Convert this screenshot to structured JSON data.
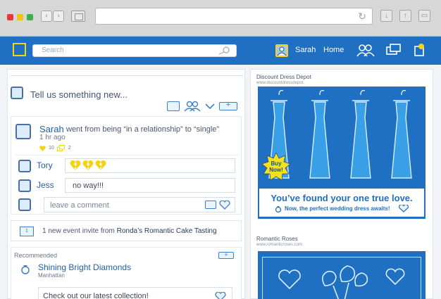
{
  "header": {
    "search_placeholder": "Search",
    "user_name": "Sarah",
    "home_label": "Home"
  },
  "composer": {
    "placeholder": "Tell us something new..."
  },
  "post": {
    "author": "Sarah",
    "action": "went from being “in a relationship” to “single”",
    "time": "1 hr ago",
    "likes": "10",
    "shares": "2",
    "comments": [
      {
        "name": "Tory",
        "text": ""
      },
      {
        "name": "Jess",
        "text": "no way!!!"
      }
    ],
    "comment_placeholder": "leave a comment"
  },
  "event": {
    "text_prefix": "1 new event invite from",
    "event_name": "Ronda’s Romantic Cake Tasting"
  },
  "recommended": {
    "label": "Recommended",
    "name": "Shining Bright Diamonds",
    "location": "Manhattan",
    "card_text": "Check out our latest collection!"
  },
  "ads": [
    {
      "title": "Discount Dress Depot",
      "url": "www.discountdressdepot.",
      "burst": [
        "Buy",
        "Now!"
      ],
      "headline": "You’ve found your one true love.",
      "subline": "Now, the perfect wedding dress awaits!"
    },
    {
      "title": "Romantic Roses",
      "url": "www.romanticroses.com"
    }
  ],
  "colors": {
    "brand": "#1f6fc2",
    "accent": "#f6d31a",
    "heart_yellow": "#f4d21a"
  }
}
